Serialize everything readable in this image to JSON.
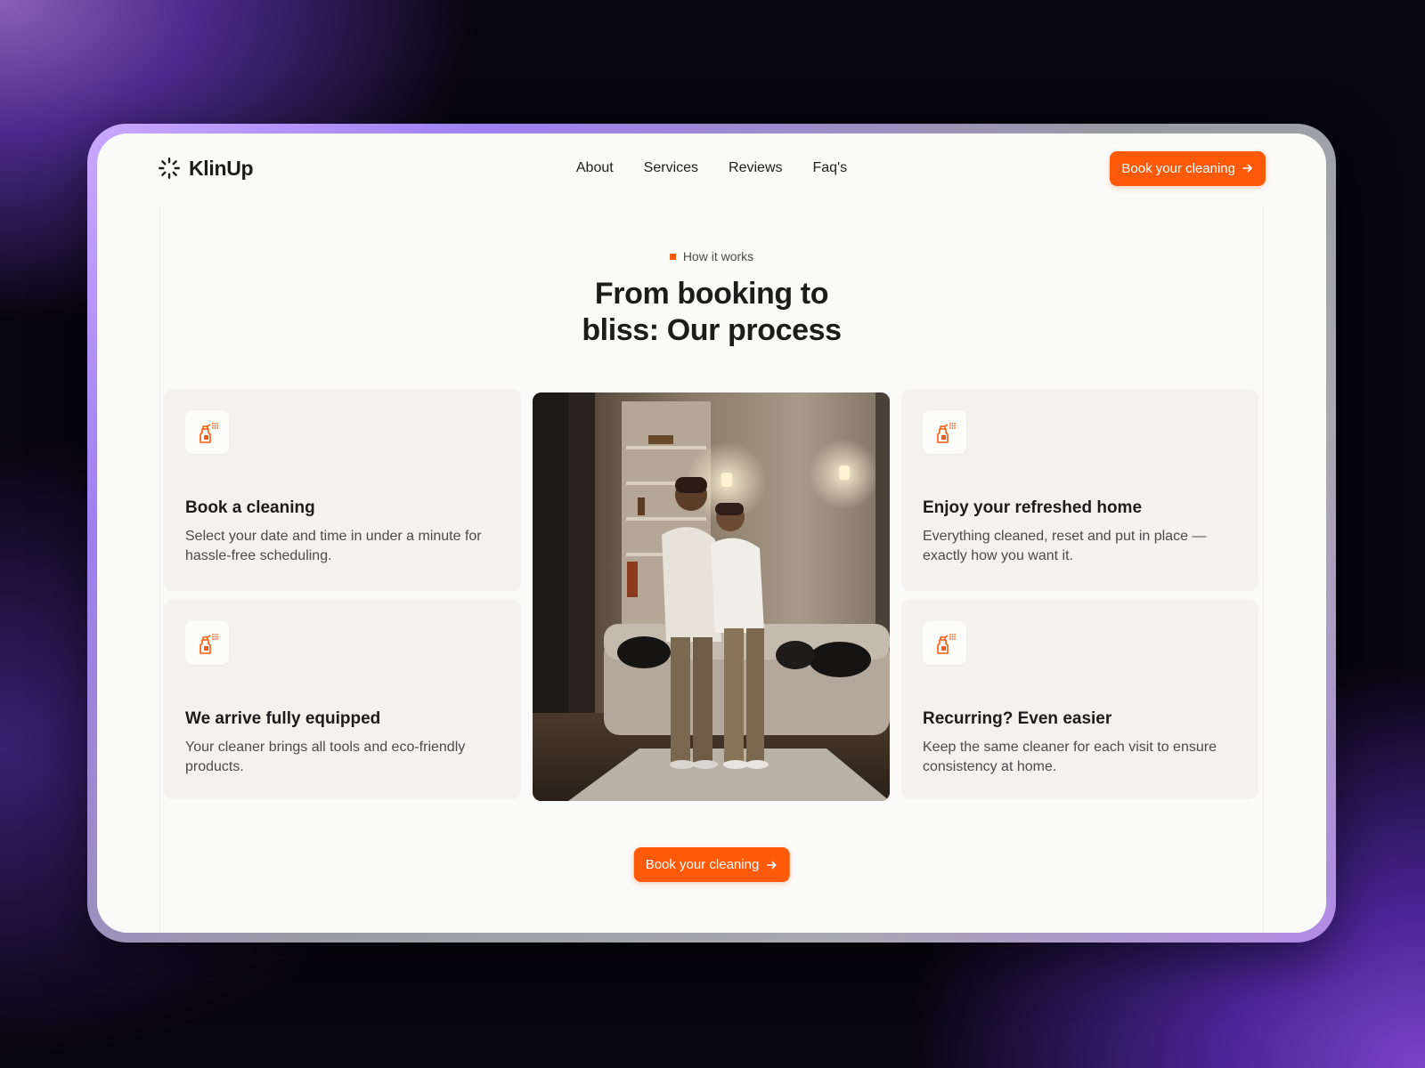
{
  "brand": {
    "name": "KlinUp",
    "accent": "#ff5a0a"
  },
  "nav": {
    "links": [
      "About",
      "Services",
      "Reviews",
      "Faq's"
    ],
    "cta_label": "Book your cleaning"
  },
  "section": {
    "eyebrow": "How it works",
    "headline_line1": "From booking to",
    "headline_line2": "bliss: Our process"
  },
  "steps": [
    {
      "icon": "spray-bottle-icon",
      "title": "Book a cleaning",
      "desc": "Select your date and time in under a minute for hassle-free scheduling."
    },
    {
      "icon": "spray-bottle-icon",
      "title": "We arrive fully equipped",
      "desc": "Your cleaner brings all tools and eco-friendly products."
    },
    {
      "icon": "spray-bottle-icon",
      "title": "Enjoy your refreshed home",
      "desc": "Everything cleaned, reset and put in place — exactly how you want it."
    },
    {
      "icon": "spray-bottle-icon",
      "title": "Recurring? Even easier",
      "desc": "Keep the same cleaner for each visit to ensure consistency at home."
    }
  ],
  "bottom_cta_label": "Book your cleaning"
}
